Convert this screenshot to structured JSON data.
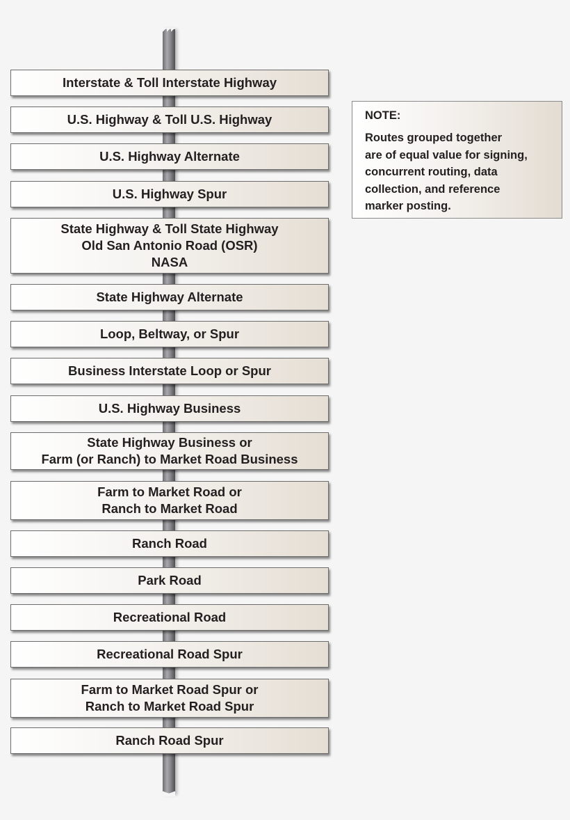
{
  "diagram": {
    "type": "route-hierarchy-signpost",
    "signs": [
      {
        "lines": [
          "Interstate & Toll Interstate Highway"
        ]
      },
      {
        "lines": [
          "U.S. Highway & Toll U.S. Highway"
        ]
      },
      {
        "lines": [
          "U.S. Highway Alternate"
        ]
      },
      {
        "lines": [
          "U.S. Highway Spur"
        ]
      },
      {
        "lines": [
          "State Highway & Toll State Highway",
          "Old San Antonio Road (OSR)",
          "NASA"
        ]
      },
      {
        "lines": [
          "State Highway Alternate"
        ]
      },
      {
        "lines": [
          "Loop, Beltway, or Spur"
        ]
      },
      {
        "lines": [
          "Business Interstate Loop or Spur"
        ]
      },
      {
        "lines": [
          "U.S. Highway Business"
        ]
      },
      {
        "lines": [
          "State Highway Business or",
          "Farm (or Ranch) to Market Road Business"
        ]
      },
      {
        "lines": [
          "Farm to Market Road or",
          "Ranch to Market Road"
        ]
      },
      {
        "lines": [
          "Ranch Road"
        ]
      },
      {
        "lines": [
          "Park Road"
        ]
      },
      {
        "lines": [
          "Recreational Road"
        ]
      },
      {
        "lines": [
          "Recreational Road Spur"
        ]
      },
      {
        "lines": [
          "Farm to Market Road Spur or",
          "Ranch to Market Road Spur"
        ]
      },
      {
        "lines": [
          "Ranch Road Spur"
        ]
      }
    ]
  },
  "note": {
    "title": "NOTE:",
    "lines": [
      "Routes grouped together",
      "are of equal value for signing,",
      "concurrent routing, data",
      "collection, and reference",
      "marker posting."
    ]
  },
  "colors": {
    "background": "#f5f5f5",
    "text": "#231f20",
    "sign_border": "#6c6c6c",
    "pole": "#8c8c90"
  }
}
